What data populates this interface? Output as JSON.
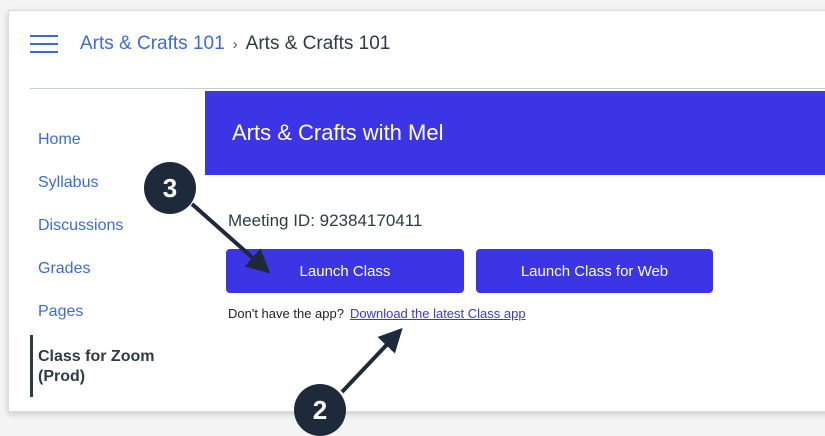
{
  "breadcrumb": {
    "course_link": "Arts & Crafts 101",
    "separator": "›",
    "current": "Arts & Crafts 101"
  },
  "sidebar": {
    "items": [
      {
        "label": "Home"
      },
      {
        "label": "Syllabus"
      },
      {
        "label": "Discussions"
      },
      {
        "label": "Grades"
      },
      {
        "label": "Pages"
      },
      {
        "label": "Class for Zoom (Prod)",
        "active": true
      }
    ]
  },
  "banner": {
    "title": "Arts & Crafts with Mel"
  },
  "meeting": {
    "label": "Meeting ID: 92384170411"
  },
  "buttons": {
    "launch": "Launch Class",
    "launch_web": "Launch Class for Web"
  },
  "app_note": {
    "text": "Don't have the app?",
    "link": "Download the latest Class app"
  },
  "callouts": {
    "step_a": "3",
    "step_b": "2"
  },
  "colors": {
    "accent": "#3c35e6",
    "link": "#3a6bd8",
    "badge": "#1e2a3a"
  }
}
